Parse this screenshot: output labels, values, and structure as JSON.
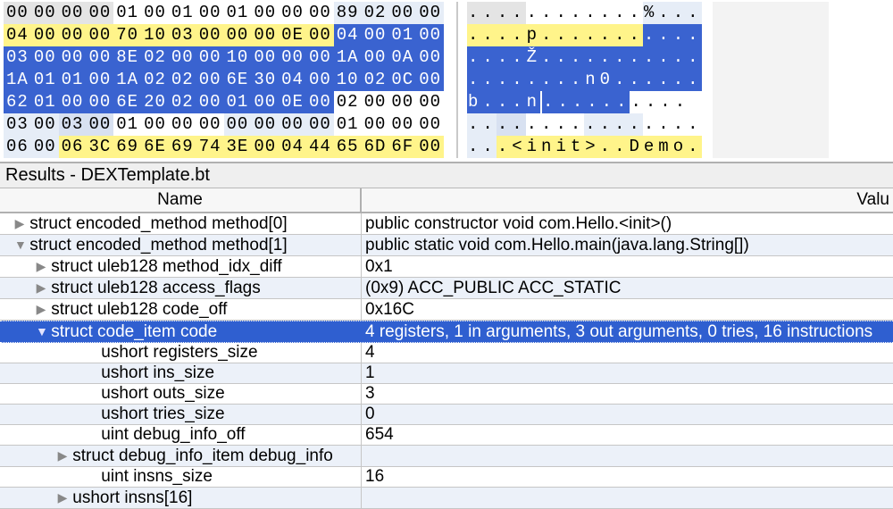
{
  "hex": {
    "rows": [
      {
        "bytes": [
          {
            "v": "00",
            "c": "bg-gray"
          },
          {
            "v": "00",
            "c": "bg-gray"
          },
          {
            "v": "00",
            "c": "bg-gray"
          },
          {
            "v": "00",
            "c": "bg-gray"
          },
          {
            "v": "01",
            "c": "bg-white"
          },
          {
            "v": "00",
            "c": "bg-white"
          },
          {
            "v": "01",
            "c": "bg-white"
          },
          {
            "v": "00",
            "c": "bg-white"
          },
          {
            "v": "01",
            "c": "bg-white"
          },
          {
            "v": "00",
            "c": "bg-white"
          },
          {
            "v": "00",
            "c": "bg-white"
          },
          {
            "v": "00",
            "c": "bg-white"
          },
          {
            "v": "89",
            "c": "bg-ltblue"
          },
          {
            "v": "02",
            "c": "bg-ltblue"
          },
          {
            "v": "00",
            "c": "bg-ltblue"
          },
          {
            "v": "00",
            "c": "bg-ltblue"
          }
        ],
        "ascii": [
          {
            "v": ".",
            "c": "bg-gray"
          },
          {
            "v": ".",
            "c": "bg-gray"
          },
          {
            "v": ".",
            "c": "bg-gray"
          },
          {
            "v": ".",
            "c": "bg-gray"
          },
          {
            "v": ".",
            "c": "bg-white"
          },
          {
            "v": ".",
            "c": "bg-white"
          },
          {
            "v": ".",
            "c": "bg-white"
          },
          {
            "v": ".",
            "c": "bg-white"
          },
          {
            "v": ".",
            "c": "bg-white"
          },
          {
            "v": ".",
            "c": "bg-white"
          },
          {
            "v": ".",
            "c": "bg-white"
          },
          {
            "v": ".",
            "c": "bg-white"
          },
          {
            "v": "%",
            "c": "bg-ltblue"
          },
          {
            "v": ".",
            "c": "bg-ltblue"
          },
          {
            "v": ".",
            "c": "bg-ltblue"
          },
          {
            "v": ".",
            "c": "bg-ltblue"
          }
        ]
      },
      {
        "bytes": [
          {
            "v": "04",
            "c": "bg-yellow"
          },
          {
            "v": "00",
            "c": "bg-yellow"
          },
          {
            "v": "00",
            "c": "bg-yellow"
          },
          {
            "v": "00",
            "c": "bg-yellow"
          },
          {
            "v": "70",
            "c": "bg-yellow"
          },
          {
            "v": "10",
            "c": "bg-yellow"
          },
          {
            "v": "03",
            "c": "bg-yellow"
          },
          {
            "v": "00",
            "c": "bg-yellow"
          },
          {
            "v": "00",
            "c": "bg-yellow"
          },
          {
            "v": "00",
            "c": "bg-yellow"
          },
          {
            "v": "0E",
            "c": "bg-yellow"
          },
          {
            "v": "00",
            "c": "bg-yellow"
          },
          {
            "v": "04",
            "c": "bg-blue"
          },
          {
            "v": "00",
            "c": "bg-blue"
          },
          {
            "v": "01",
            "c": "bg-blue"
          },
          {
            "v": "00",
            "c": "bg-blue"
          }
        ],
        "ascii": [
          {
            "v": ".",
            "c": "bg-yellow"
          },
          {
            "v": ".",
            "c": "bg-yellow"
          },
          {
            "v": ".",
            "c": "bg-yellow"
          },
          {
            "v": ".",
            "c": "bg-yellow"
          },
          {
            "v": "p",
            "c": "bg-yellow"
          },
          {
            "v": ".",
            "c": "bg-yellow"
          },
          {
            "v": ".",
            "c": "bg-yellow"
          },
          {
            "v": ".",
            "c": "bg-yellow"
          },
          {
            "v": ".",
            "c": "bg-yellow"
          },
          {
            "v": ".",
            "c": "bg-yellow"
          },
          {
            "v": ".",
            "c": "bg-yellow"
          },
          {
            "v": ".",
            "c": "bg-yellow"
          },
          {
            "v": ".",
            "c": "bg-blue"
          },
          {
            "v": ".",
            "c": "bg-blue"
          },
          {
            "v": ".",
            "c": "bg-blue"
          },
          {
            "v": ".",
            "c": "bg-blue"
          }
        ]
      },
      {
        "bytes": [
          {
            "v": "03",
            "c": "bg-blue"
          },
          {
            "v": "00",
            "c": "bg-blue"
          },
          {
            "v": "00",
            "c": "bg-blue"
          },
          {
            "v": "00",
            "c": "bg-blue"
          },
          {
            "v": "8E",
            "c": "bg-blue"
          },
          {
            "v": "02",
            "c": "bg-blue"
          },
          {
            "v": "00",
            "c": "bg-blue"
          },
          {
            "v": "00",
            "c": "bg-blue"
          },
          {
            "v": "10",
            "c": "bg-blue"
          },
          {
            "v": "00",
            "c": "bg-blue"
          },
          {
            "v": "00",
            "c": "bg-blue"
          },
          {
            "v": "00",
            "c": "bg-blue"
          },
          {
            "v": "1A",
            "c": "bg-blue"
          },
          {
            "v": "00",
            "c": "bg-blue"
          },
          {
            "v": "0A",
            "c": "bg-blue"
          },
          {
            "v": "00",
            "c": "bg-blue"
          }
        ],
        "ascii": [
          {
            "v": ".",
            "c": "bg-blue"
          },
          {
            "v": ".",
            "c": "bg-blue"
          },
          {
            "v": ".",
            "c": "bg-blue"
          },
          {
            "v": ".",
            "c": "bg-blue"
          },
          {
            "v": "Ž",
            "c": "bg-blue"
          },
          {
            "v": ".",
            "c": "bg-blue"
          },
          {
            "v": ".",
            "c": "bg-blue"
          },
          {
            "v": ".",
            "c": "bg-blue"
          },
          {
            "v": ".",
            "c": "bg-blue"
          },
          {
            "v": ".",
            "c": "bg-blue"
          },
          {
            "v": ".",
            "c": "bg-blue"
          },
          {
            "v": ".",
            "c": "bg-blue"
          },
          {
            "v": ".",
            "c": "bg-blue"
          },
          {
            "v": ".",
            "c": "bg-blue"
          },
          {
            "v": ".",
            "c": "bg-blue"
          },
          {
            "v": ".",
            "c": "bg-blue"
          }
        ]
      },
      {
        "bytes": [
          {
            "v": "1A",
            "c": "bg-blue"
          },
          {
            "v": "01",
            "c": "bg-blue"
          },
          {
            "v": "01",
            "c": "bg-blue"
          },
          {
            "v": "00",
            "c": "bg-blue"
          },
          {
            "v": "1A",
            "c": "bg-blue"
          },
          {
            "v": "02",
            "c": "bg-blue"
          },
          {
            "v": "02",
            "c": "bg-blue"
          },
          {
            "v": "00",
            "c": "bg-blue"
          },
          {
            "v": "6E",
            "c": "bg-blue"
          },
          {
            "v": "30",
            "c": "bg-blue"
          },
          {
            "v": "04",
            "c": "bg-blue"
          },
          {
            "v": "00",
            "c": "bg-blue"
          },
          {
            "v": "10",
            "c": "bg-blue"
          },
          {
            "v": "02",
            "c": "bg-blue"
          },
          {
            "v": "0C",
            "c": "bg-blue"
          },
          {
            "v": "00",
            "c": "bg-blue"
          }
        ],
        "ascii": [
          {
            "v": ".",
            "c": "bg-blue"
          },
          {
            "v": ".",
            "c": "bg-blue"
          },
          {
            "v": ".",
            "c": "bg-blue"
          },
          {
            "v": ".",
            "c": "bg-blue"
          },
          {
            "v": ".",
            "c": "bg-blue"
          },
          {
            "v": ".",
            "c": "bg-blue"
          },
          {
            "v": ".",
            "c": "bg-blue"
          },
          {
            "v": ".",
            "c": "bg-blue"
          },
          {
            "v": "n",
            "c": "bg-blue"
          },
          {
            "v": "0",
            "c": "bg-blue"
          },
          {
            "v": ".",
            "c": "bg-blue"
          },
          {
            "v": ".",
            "c": "bg-blue"
          },
          {
            "v": ".",
            "c": "bg-blue"
          },
          {
            "v": ".",
            "c": "bg-blue"
          },
          {
            "v": ".",
            "c": "bg-blue"
          },
          {
            "v": ".",
            "c": "bg-blue"
          }
        ]
      },
      {
        "bytes": [
          {
            "v": "62",
            "c": "bg-blue"
          },
          {
            "v": "01",
            "c": "bg-blue"
          },
          {
            "v": "00",
            "c": "bg-blue"
          },
          {
            "v": "00",
            "c": "bg-blue"
          },
          {
            "v": "6E",
            "c": "bg-blue"
          },
          {
            "v": "20",
            "c": "bg-blue"
          },
          {
            "v": "02",
            "c": "bg-blue"
          },
          {
            "v": "00",
            "c": "bg-blue"
          },
          {
            "v": "01",
            "c": "bg-blue"
          },
          {
            "v": "00",
            "c": "bg-blue"
          },
          {
            "v": "0E",
            "c": "bg-blue"
          },
          {
            "v": "00",
            "c": "bg-blue"
          },
          {
            "v": "02",
            "c": "bg-white"
          },
          {
            "v": "00",
            "c": "bg-white"
          },
          {
            "v": "00",
            "c": "bg-white"
          },
          {
            "v": "00",
            "c": "bg-white"
          }
        ],
        "ascii": [
          {
            "v": "b",
            "c": "bg-blue"
          },
          {
            "v": ".",
            "c": "bg-blue"
          },
          {
            "v": ".",
            "c": "bg-blue"
          },
          {
            "v": ".",
            "c": "bg-blue"
          },
          {
            "v": "n",
            "c": "bg-blue"
          },
          {
            "v": " ",
            "c": "bg-blue"
          },
          {
            "v": ".",
            "c": "bg-blue"
          },
          {
            "v": ".",
            "c": "bg-blue"
          },
          {
            "v": ".",
            "c": "bg-blue"
          },
          {
            "v": ".",
            "c": "bg-blue"
          },
          {
            "v": ".",
            "c": "bg-blue"
          },
          {
            "v": ".",
            "c": "bg-blue"
          },
          {
            "v": ".",
            "c": "bg-white"
          },
          {
            "v": ".",
            "c": "bg-white"
          },
          {
            "v": ".",
            "c": "bg-white"
          },
          {
            "v": ".",
            "c": "bg-white"
          }
        ]
      },
      {
        "bytes": [
          {
            "v": "03",
            "c": "bg-ltblue"
          },
          {
            "v": "00",
            "c": "bg-ltblue"
          },
          {
            "v": "03",
            "c": "bg-cellbl"
          },
          {
            "v": "00",
            "c": "bg-cellbl"
          },
          {
            "v": "01",
            "c": "bg-white"
          },
          {
            "v": "00",
            "c": "bg-white"
          },
          {
            "v": "00",
            "c": "bg-white"
          },
          {
            "v": "00",
            "c": "bg-white"
          },
          {
            "v": "00",
            "c": "bg-ltblue"
          },
          {
            "v": "00",
            "c": "bg-ltblue"
          },
          {
            "v": "00",
            "c": "bg-ltblue"
          },
          {
            "v": "00",
            "c": "bg-ltblue"
          },
          {
            "v": "01",
            "c": "bg-white"
          },
          {
            "v": "00",
            "c": "bg-white"
          },
          {
            "v": "00",
            "c": "bg-white"
          },
          {
            "v": "00",
            "c": "bg-white"
          }
        ],
        "ascii": [
          {
            "v": ".",
            "c": "bg-ltblue"
          },
          {
            "v": ".",
            "c": "bg-ltblue"
          },
          {
            "v": ".",
            "c": "bg-cellbl"
          },
          {
            "v": ".",
            "c": "bg-cellbl"
          },
          {
            "v": ".",
            "c": "bg-white"
          },
          {
            "v": ".",
            "c": "bg-white"
          },
          {
            "v": ".",
            "c": "bg-white"
          },
          {
            "v": ".",
            "c": "bg-white"
          },
          {
            "v": ".",
            "c": "bg-ltblue"
          },
          {
            "v": ".",
            "c": "bg-ltblue"
          },
          {
            "v": ".",
            "c": "bg-ltblue"
          },
          {
            "v": ".",
            "c": "bg-ltblue"
          },
          {
            "v": ".",
            "c": "bg-white"
          },
          {
            "v": ".",
            "c": "bg-white"
          },
          {
            "v": ".",
            "c": "bg-white"
          },
          {
            "v": ".",
            "c": "bg-white"
          }
        ]
      },
      {
        "bytes": [
          {
            "v": "06",
            "c": "bg-ltblue"
          },
          {
            "v": "00",
            "c": "bg-ltblue"
          },
          {
            "v": "06",
            "c": "bg-yellow"
          },
          {
            "v": "3C",
            "c": "bg-yellow"
          },
          {
            "v": "69",
            "c": "bg-yellow"
          },
          {
            "v": "6E",
            "c": "bg-yellow"
          },
          {
            "v": "69",
            "c": "bg-yellow"
          },
          {
            "v": "74",
            "c": "bg-yellow"
          },
          {
            "v": "3E",
            "c": "bg-yellow"
          },
          {
            "v": "00",
            "c": "bg-yellow"
          },
          {
            "v": "04",
            "c": "bg-yellow"
          },
          {
            "v": "44",
            "c": "bg-yellow"
          },
          {
            "v": "65",
            "c": "bg-yellow"
          },
          {
            "v": "6D",
            "c": "bg-yellow"
          },
          {
            "v": "6F",
            "c": "bg-yellow"
          },
          {
            "v": "00",
            "c": "bg-yellow"
          }
        ],
        "ascii": [
          {
            "v": ".",
            "c": "bg-ltblue"
          },
          {
            "v": ".",
            "c": "bg-ltblue"
          },
          {
            "v": ".",
            "c": "bg-yellow"
          },
          {
            "v": "<",
            "c": "bg-yellow"
          },
          {
            "v": "i",
            "c": "bg-yellow"
          },
          {
            "v": "n",
            "c": "bg-yellow"
          },
          {
            "v": "i",
            "c": "bg-yellow"
          },
          {
            "v": "t",
            "c": "bg-yellow"
          },
          {
            "v": ">",
            "c": "bg-yellow"
          },
          {
            "v": ".",
            "c": "bg-yellow"
          },
          {
            "v": ".",
            "c": "bg-yellow"
          },
          {
            "v": "D",
            "c": "bg-yellow"
          },
          {
            "v": "e",
            "c": "bg-yellow"
          },
          {
            "v": "m",
            "c": "bg-yellow"
          },
          {
            "v": "o",
            "c": "bg-yellow"
          },
          {
            "v": ".",
            "c": "bg-yellow"
          }
        ]
      }
    ]
  },
  "results_title": "Results - DEXTemplate.bt",
  "columns": {
    "name": "Name",
    "value": "Valu"
  },
  "rows": [
    {
      "indent": 0,
      "tri": "right",
      "name": "struct encoded_method method[0]",
      "value": "public constructor void com.Hello.<init>()",
      "alt": "odd"
    },
    {
      "indent": 0,
      "tri": "down",
      "name": "struct encoded_method method[1]",
      "value": "public static void com.Hello.main(java.lang.String[])",
      "alt": "even"
    },
    {
      "indent": 1,
      "tri": "right",
      "name": "struct uleb128 method_idx_diff",
      "value": "0x1",
      "alt": "odd"
    },
    {
      "indent": 1,
      "tri": "right",
      "name": "struct uleb128 access_flags",
      "value": "(0x9) ACC_PUBLIC ACC_STATIC",
      "alt": "even"
    },
    {
      "indent": 1,
      "tri": "right",
      "name": "struct uleb128 code_off",
      "value": "0x16C",
      "alt": "odd"
    },
    {
      "indent": 1,
      "tri": "down",
      "name": "struct code_item code",
      "value": "4 registers, 1 in arguments, 3 out arguments, 0 tries, 16 instructions",
      "alt": "sel"
    },
    {
      "indent": 3,
      "tri": "",
      "name": "ushort registers_size",
      "value": "4",
      "alt": "odd"
    },
    {
      "indent": 3,
      "tri": "",
      "name": "ushort ins_size",
      "value": "1",
      "alt": "even"
    },
    {
      "indent": 3,
      "tri": "",
      "name": "ushort outs_size",
      "value": "3",
      "alt": "odd"
    },
    {
      "indent": 3,
      "tri": "",
      "name": "ushort tries_size",
      "value": "0",
      "alt": "even"
    },
    {
      "indent": 3,
      "tri": "",
      "name": "uint debug_info_off",
      "value": "654",
      "alt": "odd"
    },
    {
      "indent": 2,
      "tri": "right",
      "name": "struct debug_info_item debug_info",
      "value": "",
      "alt": "even"
    },
    {
      "indent": 3,
      "tri": "",
      "name": "uint insns_size",
      "value": "16",
      "alt": "odd"
    },
    {
      "indent": 2,
      "tri": "right",
      "name": "ushort insns[16]",
      "value": "",
      "alt": "even"
    }
  ]
}
